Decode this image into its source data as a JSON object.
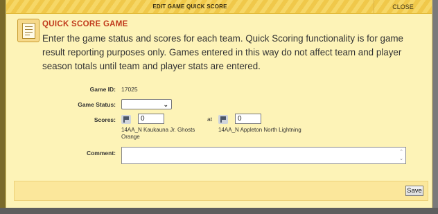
{
  "dialog": {
    "title": "EDIT GAME QUICK SCORE",
    "close_label": "CLOSE",
    "heading": "QUICK SCORE GAME",
    "intro": "Enter the game status and scores for each team. Quick Scoring functionality is for game result reporting purposes only. Games entered in this way do not affect team and player season totals until team and player stats are entered."
  },
  "form": {
    "game_id_label": "Game ID:",
    "game_id_value": "17025",
    "game_status_label": "Game Status:",
    "game_status_value": "",
    "scores_label": "Scores:",
    "at_text": "at",
    "home_team": {
      "score": "0",
      "name": "14AA_N Kaukauna Jr. Ghosts Orange",
      "icon": "flag-icon"
    },
    "away_team": {
      "score": "0",
      "name": "14AA_N Appleton North Lightning",
      "icon": "flag-icon"
    },
    "comment_label": "Comment:",
    "comment_value": ""
  },
  "footer": {
    "save_label": "Save"
  },
  "colors": {
    "dialog_bg": "#fdf3b7",
    "titlebar": "#f0c84a",
    "heading": "#c0391b",
    "footer_bg": "#fbe79b"
  }
}
